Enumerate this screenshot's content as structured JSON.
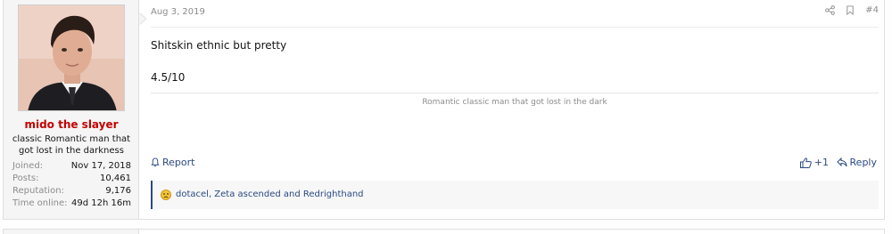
{
  "post": {
    "date": "Aug 3, 2019",
    "number": "#4",
    "message_lines": [
      "Shitskin ethnic but pretty",
      "4.5/10"
    ],
    "signature": "Romantic classic man that got lost in the dark",
    "actions": {
      "report": "Report",
      "like_count": "+1",
      "reply": "Reply"
    },
    "reactions": {
      "emoji": "sad-face-icon",
      "text": "dotacel, Zeta ascended and Redrighthand"
    }
  },
  "user": {
    "name": "mido the slayer",
    "title": "classic Romantic man that got lost in the darkness",
    "stats": [
      {
        "label": "Joined:",
        "value": "Nov 17, 2018"
      },
      {
        "label": "Posts:",
        "value": "10,461"
      },
      {
        "label": "Reputation:",
        "value": "9,176"
      },
      {
        "label": "Time online:",
        "value": "49d 12h 16m"
      }
    ]
  },
  "colors": {
    "username": "#c40000",
    "link": "#2b4a82",
    "muted": "#8c8c8c"
  }
}
